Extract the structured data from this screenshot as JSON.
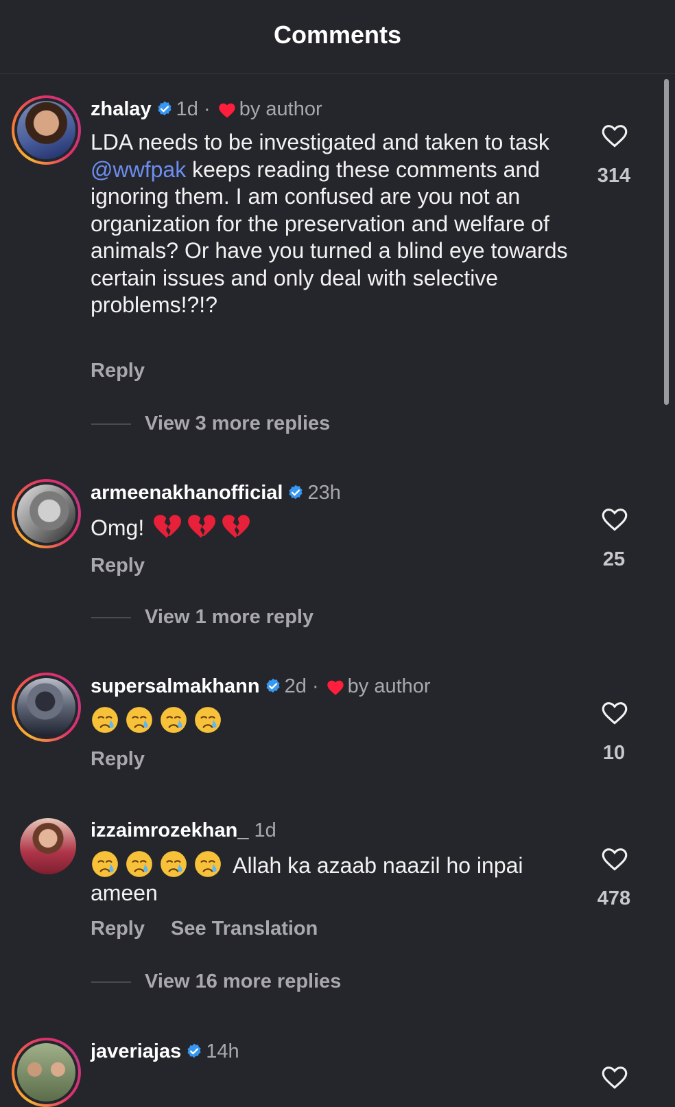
{
  "header": {
    "title": "Comments"
  },
  "comments": [
    {
      "username": "zhalay",
      "time": "1d",
      "separator": "·",
      "liked_by_author": "by author",
      "text_parts": [
        "LDA needs to be investigated and taken to task ",
        "@wwfpak",
        " keeps reading these comments and ignoring them. I am confused are you not an organization for the preservation and welfare of animals? Or have you turned a blind eye towards certain issues and only deal with selective problems!?!?"
      ],
      "reply_label": "Reply",
      "view_replies": "View 3 more replies",
      "likes": "314"
    },
    {
      "username": "armeenakhanofficial",
      "time": "23h",
      "text": "Omg!",
      "emojis": [
        "broken-heart-emoji",
        "broken-heart-emoji",
        "broken-heart-emoji"
      ],
      "reply_label": "Reply",
      "view_replies": "View 1 more reply",
      "likes": "25"
    },
    {
      "username": "supersalmakhann",
      "time": "2d",
      "separator": "·",
      "liked_by_author": "by author",
      "emojis": [
        "crying-face-emoji",
        "crying-face-emoji",
        "crying-face-emoji",
        "crying-face-emoji"
      ],
      "reply_label": "Reply",
      "likes": "10"
    },
    {
      "username": "izzaimrozekhan_",
      "time": "1d",
      "emojis": [
        "crying-face-emoji",
        "crying-face-emoji",
        "crying-face-emoji",
        "crying-face-emoji"
      ],
      "text": "Allah ka azaab naazil ho inpai ameen",
      "reply_label": "Reply",
      "see_translation": "See Translation",
      "view_replies": "View 16 more replies",
      "likes": "478"
    },
    {
      "username": "javeriajas",
      "time": "14h"
    }
  ],
  "colors": {
    "background": "#25262b",
    "verified": "#3897f0",
    "mention": "#6d8ef0",
    "author_heart": "#ff1f3d"
  }
}
